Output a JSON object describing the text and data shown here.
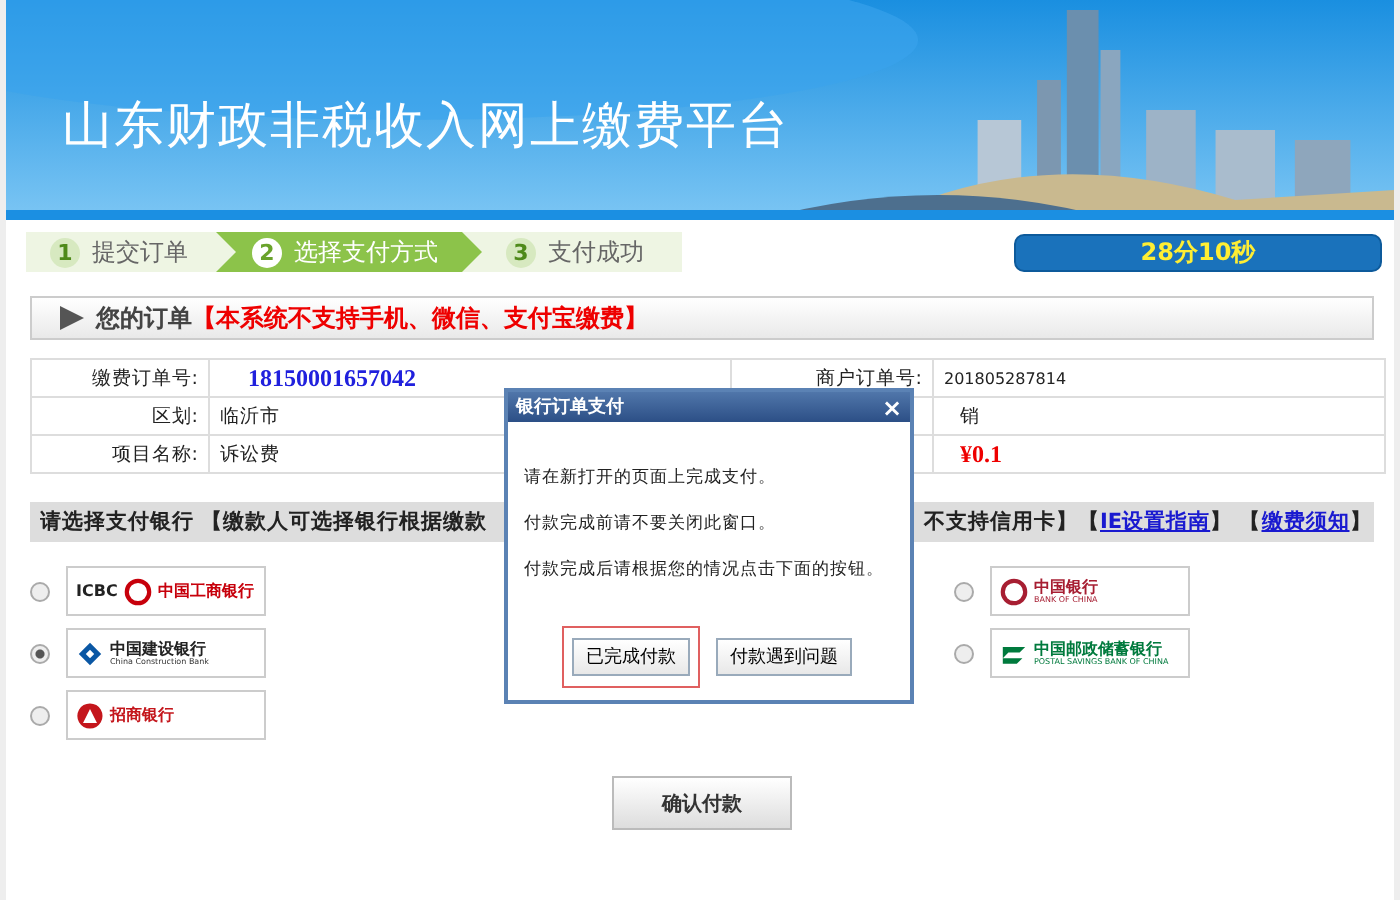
{
  "banner": {
    "title": "山东财政非税收入网上缴费平台"
  },
  "steps": [
    {
      "number": "1",
      "label": "提交订单",
      "selected": false
    },
    {
      "number": "2",
      "label": "选择支付方式",
      "selected": true
    },
    {
      "number": "3",
      "label": "支付成功",
      "selected": false
    }
  ],
  "timer": "28分10秒",
  "order_section": {
    "title": "您的订单",
    "notice": "【本系统不支持手机、微信、支付宝缴费】"
  },
  "order_table": {
    "rows": [
      {
        "label": "缴费订单号:",
        "value": "18150001657042",
        "kind": "order-number",
        "label_2": "商户订单号:",
        "value_2": {
          "text": "201805287814",
          "kind": "small"
        }
      },
      {
        "label": "区划:",
        "value": "临沂市",
        "kind": "plain",
        "value_2": {
          "text": "销",
          "kind": "plain"
        }
      },
      {
        "label": "项目名称:",
        "value": "诉讼费",
        "kind": "plain",
        "value_2": {
          "text": "¥0.1",
          "kind": "amount"
        }
      }
    ]
  },
  "bank_bar": {
    "left_text": "请选择支付银行 【缴款人可选择银行根据缴款",
    "right_parts": [
      {
        "kind": "text",
        "text": "不支持信用卡】【"
      },
      {
        "kind": "link",
        "text": "IE设置指南"
      },
      {
        "kind": "text",
        "text": "】 【"
      },
      {
        "kind": "link",
        "text": "缴费须知"
      },
      {
        "kind": "text",
        "text": "】"
      }
    ]
  },
  "banks_left": [
    {
      "kind": "icbc",
      "name": "中国工商银行",
      "mark": "ICBC",
      "selected": false
    },
    {
      "kind": "ccb",
      "name": "中国建设银行",
      "subtitle": "China Construction Bank",
      "selected": true
    },
    {
      "kind": "cmb",
      "name": "招商银行",
      "selected": false
    }
  ],
  "banks_right": [
    {
      "kind": "boc",
      "name": "中国银行",
      "subtitle": "BANK OF CHINA",
      "selected": false
    },
    {
      "kind": "psbc",
      "name": "中国邮政储蓄银行",
      "subtitle": "POSTAL SAVINGS BANK OF CHINA",
      "selected": false
    }
  ],
  "confirm_button": "确认付款",
  "dialog": {
    "title": "银行订单支付",
    "close": "×",
    "lines": [
      "请在新打开的页面上完成支付。",
      "付款完成前请不要关闭此窗口。",
      "付款完成后请根据您的情况点击下面的按钮。"
    ],
    "buttons": [
      {
        "label": "已完成付款",
        "focused": true
      },
      {
        "label": "付款遇到问题",
        "focused": false
      }
    ]
  }
}
